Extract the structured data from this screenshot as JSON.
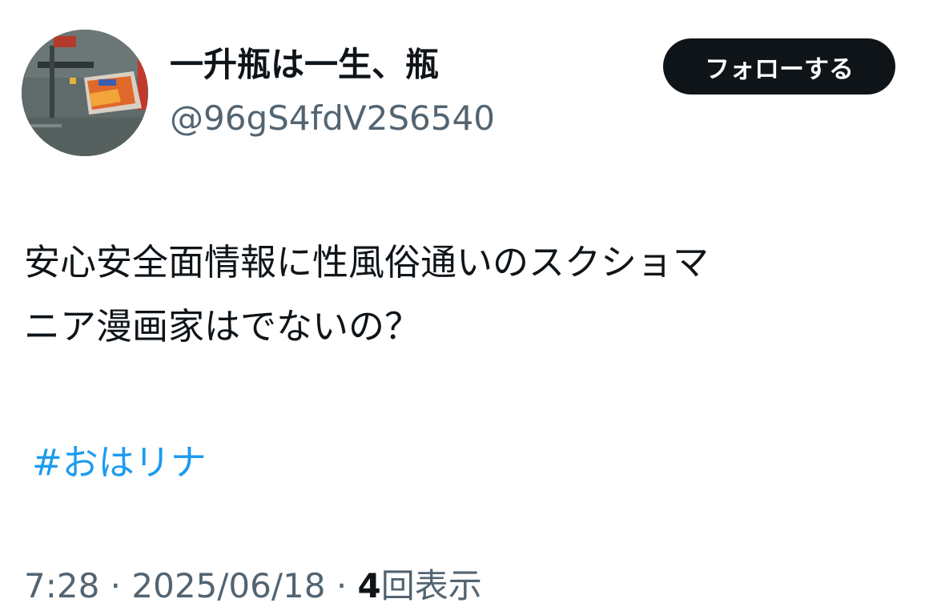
{
  "author": {
    "display_name": "一升瓶は一生、瓶",
    "handle": "@96gS4fdV2S6540"
  },
  "follow_button": {
    "label": "フォローする"
  },
  "tweet": {
    "text_line1": "安心安全面情報に性風俗通いのスクショマ",
    "text_line2": "ニア漫画家はでないの？",
    "hashtag": "#おはリナ"
  },
  "meta": {
    "time": "7:28",
    "separator": " · ",
    "date": "2025/06/18",
    "views_count": "4",
    "views_label": "回表示"
  },
  "colors": {
    "text": "#0f1419",
    "secondary": "#536471",
    "link": "#1d9bf0",
    "button_bg": "#0f1419"
  }
}
